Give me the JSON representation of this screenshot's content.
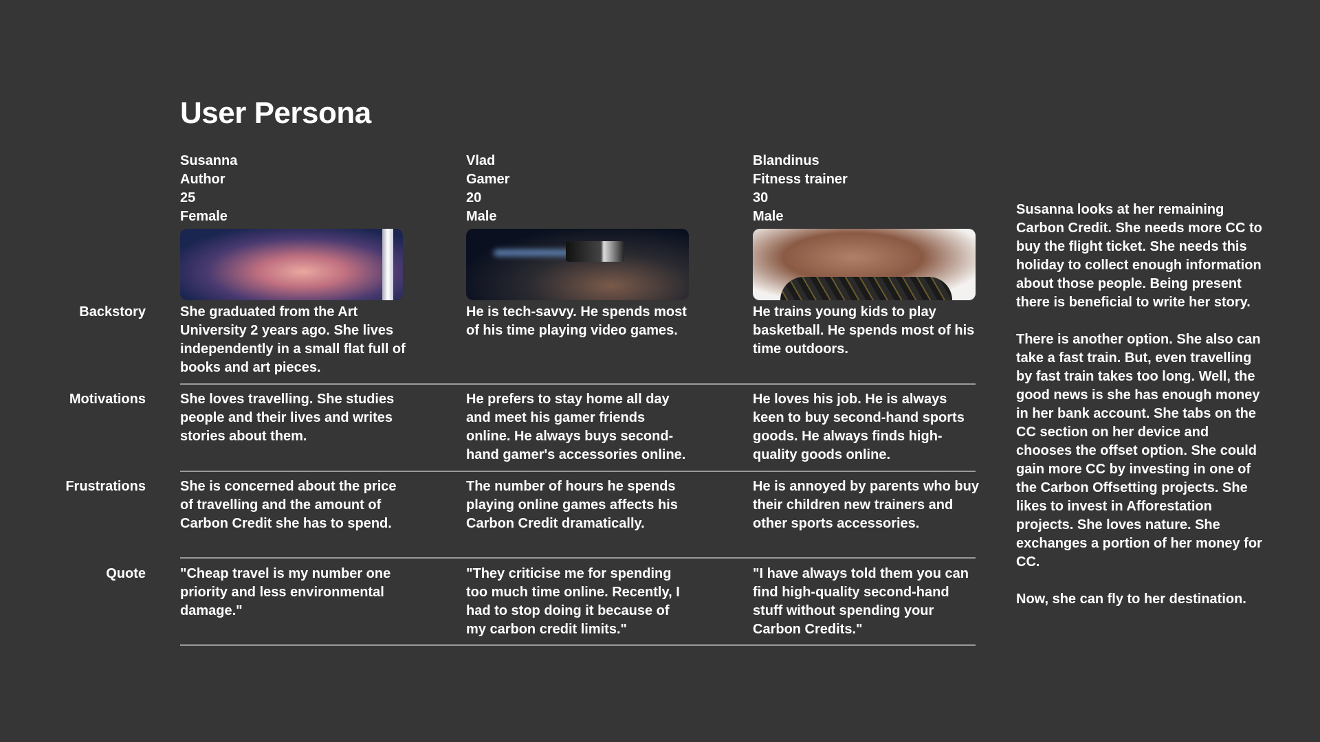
{
  "title": "User Persona",
  "row_labels": [
    "Backstory",
    "Motivations",
    "Frustrations",
    "Quote"
  ],
  "personas": [
    {
      "name": "Susanna",
      "occupation": "Author",
      "age": "25",
      "gender": "Female",
      "backstory": "She graduated from the Art University 2 years ago. She lives independently in a small flat full of books and art pieces.",
      "motivations": "She loves travelling. She studies people and their lives and writes stories about them.",
      "frustrations": "She is concerned about the price of travelling and the amount of Carbon Credit she has to spend.",
      "quote": "\"Cheap travel is my number one priority and less environmental damage.\""
    },
    {
      "name": "Vlad",
      "occupation": "Gamer",
      "age": "20",
      "gender": "Male",
      "backstory": "He is tech-savvy. He spends most of his time playing video games.",
      "motivations": "He prefers to stay home all day and meet his gamer friends online. He always buys second-hand gamer's accessories online.",
      "frustrations": "The number of hours he spends playing online games affects his Carbon Credit dramatically.",
      "quote": "\"They criticise me for spending too much time online. Recently, I had to stop doing it because of my carbon credit limits.\""
    },
    {
      "name": "Blandinus",
      "occupation": "Fitness trainer",
      "age": "30",
      "gender": "Male",
      "backstory": "He trains young kids to play basketball. He spends most of his time outdoors.",
      "motivations": "He loves his job. He is always keen to buy second-hand sports goods. He always finds high-quality goods online.",
      "frustrations": "He is annoyed by parents who buy their children new trainers and other sports accessories.",
      "quote": "\"I have always told them you can find high-quality second-hand stuff without spending your Carbon Credits.\""
    }
  ],
  "story": [
    "Susanna looks at her remaining Carbon Credit. She needs more CC to buy the flight ticket. She needs this holiday to collect enough information about those people. Being present there is beneficial to write her story.",
    "There is another option. She also can take a fast train. But, even travelling by fast train takes too long. Well, the good news is she has enough money in her bank account. She tabs on the CC section on her device and chooses the offset option. She could gain more CC by investing in one of the Carbon Offsetting projects. She likes to invest in Afforestation projects. She loves nature. She exchanges a portion of her money for CC.",
    "Now, she can fly to her destination."
  ]
}
